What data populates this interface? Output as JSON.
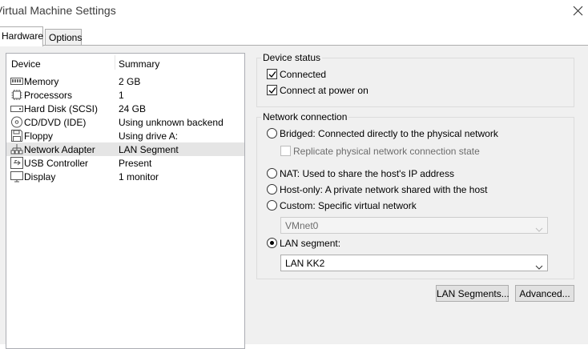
{
  "window": {
    "title": "Virtual Machine Settings"
  },
  "tabs": [
    {
      "label": "Hardware",
      "selected": true
    },
    {
      "label": "Options",
      "selected": false
    }
  ],
  "devices": {
    "columns": [
      "Device",
      "Summary"
    ],
    "rows": [
      {
        "name": "Memory",
        "summary": "2 GB",
        "icon": "memory-icon"
      },
      {
        "name": "Processors",
        "summary": "1",
        "icon": "processor-icon"
      },
      {
        "name": "Hard Disk (SCSI)",
        "summary": "24 GB",
        "icon": "hard-disk-icon"
      },
      {
        "name": "CD/DVD (IDE)",
        "summary": "Using unknown backend",
        "icon": "cd-dvd-icon"
      },
      {
        "name": "Floppy",
        "summary": "Using drive A:",
        "icon": "floppy-icon"
      },
      {
        "name": "Network Adapter",
        "summary": "LAN Segment",
        "icon": "network-adapter-icon",
        "selected": true
      },
      {
        "name": "USB Controller",
        "summary": "Present",
        "icon": "usb-icon"
      },
      {
        "name": "Display",
        "summary": "1 monitor",
        "icon": "display-icon"
      }
    ]
  },
  "device_status": {
    "legend": "Device status",
    "connected": {
      "label": "Connected",
      "checked": true
    },
    "connect_at_power_on": {
      "label": "Connect at power on",
      "checked": true
    }
  },
  "network_connection": {
    "legend": "Network connection",
    "bridged": {
      "label": "Bridged: Connected directly to the physical network",
      "selected": false
    },
    "replicate": {
      "label": "Replicate physical network connection state",
      "checked": false,
      "enabled": false
    },
    "nat": {
      "label": "NAT: Used to share the host's IP address",
      "selected": false
    },
    "host_only": {
      "label": "Host-only: A private network shared with the host",
      "selected": false
    },
    "custom": {
      "label": "Custom: Specific virtual network",
      "selected": false
    },
    "vmnet": {
      "value": "VMnet0",
      "enabled": false
    },
    "lan_segment": {
      "label": "LAN segment:",
      "selected": true
    },
    "lan_value": {
      "value": "LAN KK2"
    }
  },
  "buttons": {
    "lan_segments": "LAN Segments...",
    "advanced": "Advanced..."
  }
}
